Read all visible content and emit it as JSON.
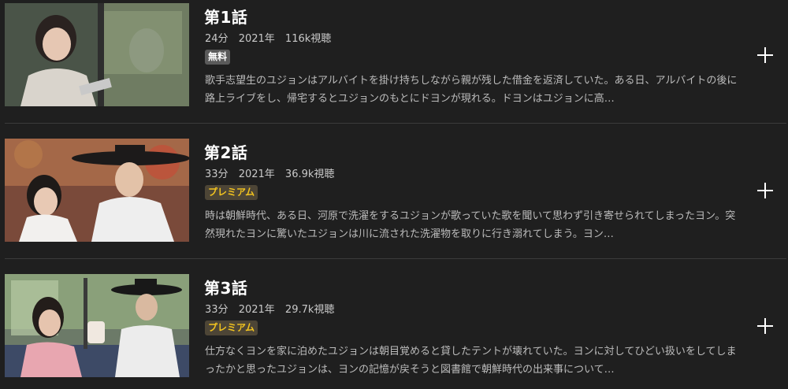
{
  "episodes": [
    {
      "title": "第1話",
      "duration": "24分",
      "year": "2021年",
      "views": "116k視聴",
      "badge": "無料",
      "badge_type": "free",
      "description": "歌手志望生のユジョンはアルバイトを掛け持ちしながら親が残した借金を返済していた。ある日、アルバイトの後に路上ライブをし、帰宅するとユジョンのもとにドヨンが現れる。ドヨンはユジョンに高…",
      "add_icon": "plus-icon"
    },
    {
      "title": "第2話",
      "duration": "33分",
      "year": "2021年",
      "views": "36.9k視聴",
      "badge": "プレミアム",
      "badge_type": "premium",
      "description": "時は朝鮮時代、ある日、河原で洗濯をするユジョンが歌っていた歌を聞いて思わず引き寄せられてしまったヨン。突然現れたヨンに驚いたユジョンは川に流された洗濯物を取りに行き溺れてしまう。ヨン…",
      "add_icon": "plus-icon"
    },
    {
      "title": "第3話",
      "duration": "33分",
      "year": "2021年",
      "views": "29.7k視聴",
      "badge": "プレミアム",
      "badge_type": "premium",
      "description": "仕方なくヨンを家に泊めたユジョンは朝目覚めると貸したテントが壊れていた。ヨンに対してひどい扱いをしてしまったかと思ったユジョンは、ヨンの記憶が戻そうと図書館で朝鮮時代の出来事について…",
      "add_icon": "plus-icon"
    }
  ],
  "colors": {
    "background": "#1f1f1f",
    "premium_badge_text": "#f3c41f",
    "free_badge_bg": "#5a5a5a"
  }
}
